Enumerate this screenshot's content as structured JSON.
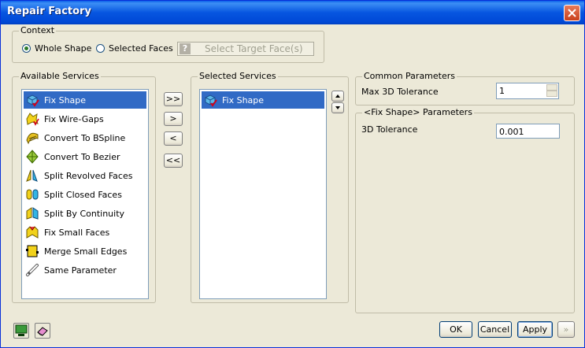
{
  "window": {
    "title": "Repair Factory"
  },
  "context": {
    "legend": "Context",
    "options": [
      {
        "label": "Whole Shape",
        "selected": true
      },
      {
        "label": "Selected Faces",
        "selected": false
      }
    ],
    "target_button": "Select Target Face(s)",
    "target_icon_glyph": "?"
  },
  "available": {
    "legend": "Available Services",
    "items": [
      {
        "label": "Fix Shape",
        "icon": "fix-shape-icon",
        "selected": true
      },
      {
        "label": "Fix Wire-Gaps",
        "icon": "fix-wire-gaps-icon"
      },
      {
        "label": "Convert To BSpline",
        "icon": "convert-bspline-icon"
      },
      {
        "label": "Convert To Bezier",
        "icon": "convert-bezier-icon"
      },
      {
        "label": "Split Revolved Faces",
        "icon": "split-revolved-icon"
      },
      {
        "label": "Split Closed Faces",
        "icon": "split-closed-icon"
      },
      {
        "label": "Split By Continuity",
        "icon": "split-continuity-icon"
      },
      {
        "label": "Fix Small Faces",
        "icon": "fix-small-faces-icon"
      },
      {
        "label": "Merge Small Edges",
        "icon": "merge-edges-icon"
      },
      {
        "label": "Same Parameter",
        "icon": "same-parameter-icon"
      }
    ]
  },
  "transfer_buttons": {
    "add_all": ">>",
    "add": ">",
    "remove": "<",
    "remove_all": "<<"
  },
  "selected": {
    "legend": "Selected Services",
    "items": [
      {
        "label": "Fix Shape",
        "icon": "fix-shape-icon",
        "selected": true
      }
    ]
  },
  "common": {
    "legend": "Common Parameters",
    "max_tol_label": "Max 3D Tolerance",
    "max_tol_value": "1"
  },
  "fix_params": {
    "legend": "<Fix Shape> Parameters",
    "tol_label": "3D Tolerance",
    "tol_value": "0.001"
  },
  "footer": {
    "ok": "OK",
    "cancel": "Cancel",
    "apply": "Apply",
    "next": "»"
  },
  "colors": {
    "selection": "#316ac5",
    "titlebar": "#0756e0"
  }
}
